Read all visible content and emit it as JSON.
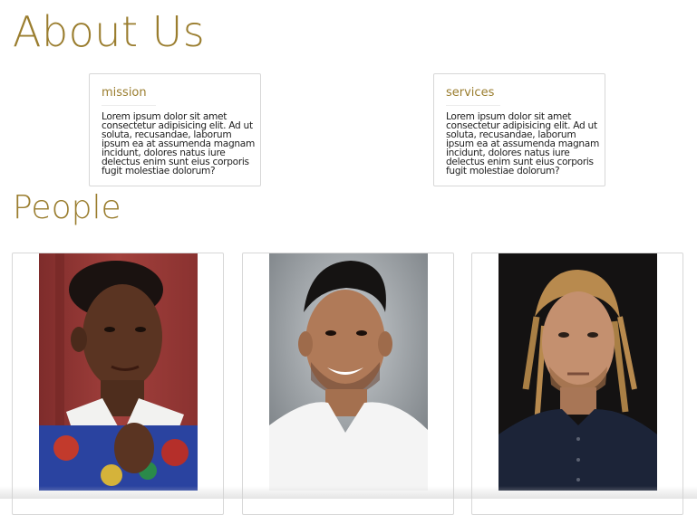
{
  "sections": {
    "about_title": "About Us",
    "people_title": "People"
  },
  "cards": [
    {
      "title": "mission",
      "text": "Lorem ipsum dolor sit amet consectetur adipisicing elit. Ad ut soluta, recusandae, laborum ipsum ea at assumenda magnam incidunt, dolores natus iure delectus enim sunt eius corporis fugit molestiae dolorum?"
    },
    {
      "title": "services",
      "text": "Lorem ipsum dolor sit amet consectetur adipisicing elit. Ad ut soluta, recusandae, laborum ipsum ea at assumenda magnam incidunt, dolores natus iure delectus enim sunt eius corporis fugit molestiae dolorum?"
    }
  ],
  "people": [
    {
      "photo": "person-photo-1"
    },
    {
      "photo": "person-photo-2"
    },
    {
      "photo": "person-photo-3"
    }
  ],
  "colors": {
    "accent": "#9a7d2e",
    "border": "#d7d7d7"
  }
}
